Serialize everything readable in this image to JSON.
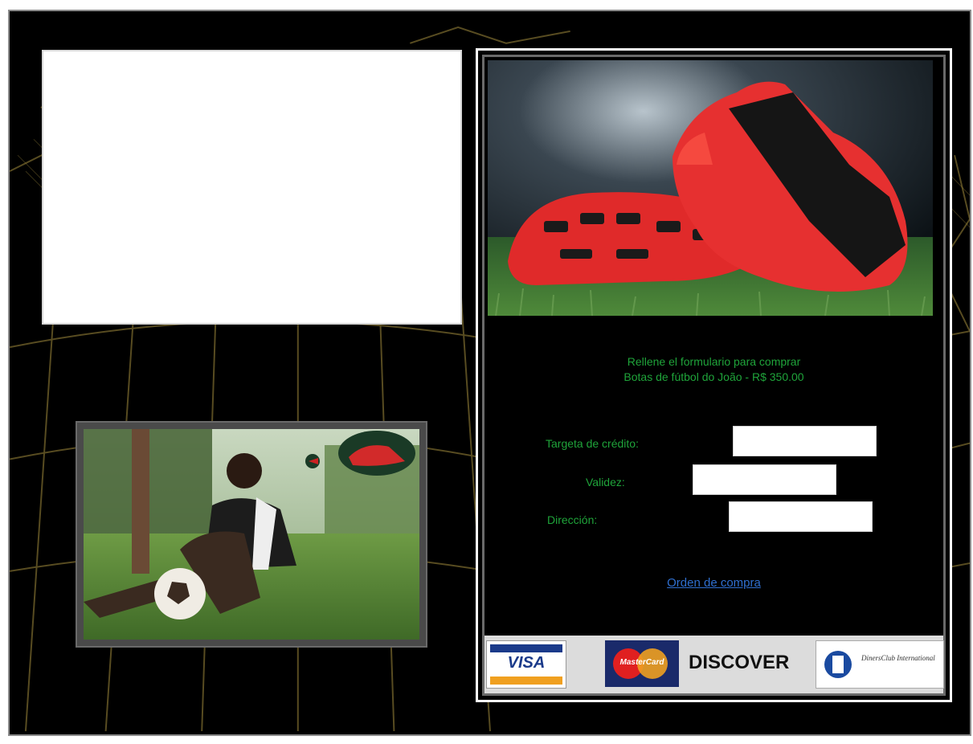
{
  "headline": {
    "line1": "Rellene el formulario para comprar",
    "line2": "Botas de fútbol do João - R$ 350.00"
  },
  "form": {
    "card_label": "Targeta de crédito:",
    "validity_label": "Validez:",
    "address_label": "Dirección:",
    "card_value": "",
    "validity_value": "",
    "address_value": ""
  },
  "order_link": "Orden de compra",
  "payment_cards": {
    "visa": "VISA",
    "mastercard": "MasterCard",
    "discover": "DISCOVER",
    "diners": "DinersClub International"
  },
  "colors": {
    "background": "#000000",
    "text_green": "#1fa43a",
    "link_blue": "#2f6fd0",
    "net_gold": "#a08a3c"
  }
}
